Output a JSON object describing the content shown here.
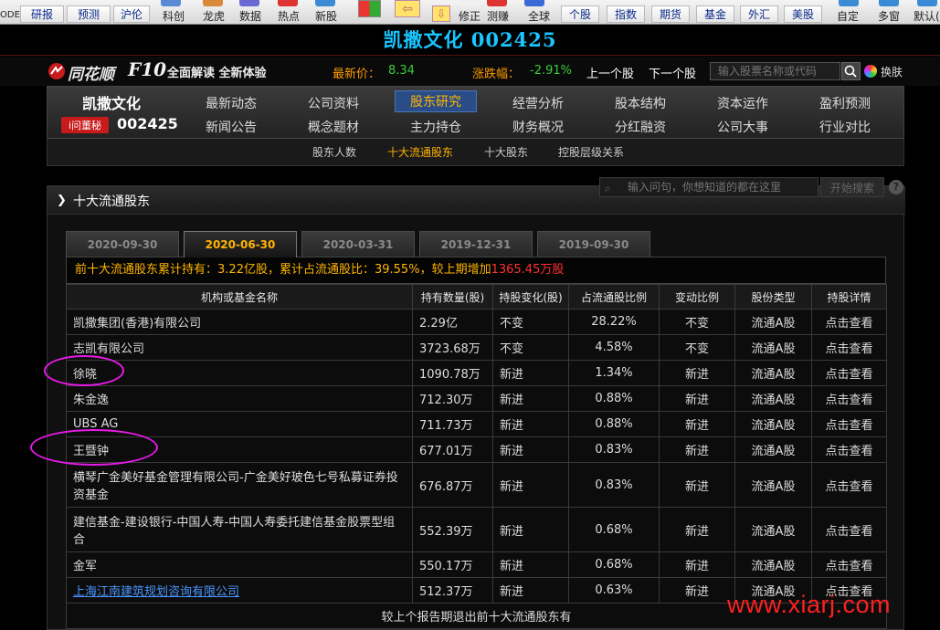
{
  "toolbar": {
    "top_buttons": [
      "研报",
      "预测",
      "沪伦",
      "个股",
      "指数",
      "期货",
      "基金",
      "外汇",
      "美股"
    ],
    "labels": [
      "科创",
      "龙虎",
      "数据",
      "热点",
      "新股",
      "修正",
      "测赚",
      "全球",
      "自定",
      "多窗",
      "默认(",
      "ODE"
    ]
  },
  "title": "凯撒文化 002425",
  "header": {
    "app_name": "同花顺",
    "app_suffix": "F10",
    "slogan": "全面解读 全新体验",
    "price_label": "最新价：",
    "price_value": "8.34",
    "change_label": "涨跌幅：",
    "change_value": "-2.91%",
    "prev_stock": "上一个股",
    "next_stock": "下一个股",
    "search_placeholder": "输入股票名称或代码",
    "switch_label": "换肤"
  },
  "nav": {
    "stock_name": "凯撒文化",
    "badge": "i问董秘",
    "stock_code": "002425",
    "row1": [
      "最新动态",
      "公司资料",
      "股东研究",
      "经营分析",
      "股本结构",
      "资本运作",
      "盈利预测"
    ],
    "row2": [
      "新闻公告",
      "概念题材",
      "主力持仓",
      "财务概况",
      "分红融资",
      "公司大事",
      "行业对比"
    ],
    "sub": [
      "股东人数",
      "十大流通股东",
      "十大股东",
      "控股层级关系"
    ]
  },
  "section": {
    "title": "十大流通股东",
    "ask_placeholder": "输入问句，你想知道的都在这里",
    "ask_button": "开始搜索",
    "help": "?"
  },
  "tabs": [
    "2020-09-30",
    "2020-06-30",
    "2020-03-31",
    "2019-12-31",
    "2019-09-30"
  ],
  "summary": {
    "p1": "前十大流通股东累计持有：",
    "holding": "3.22亿股",
    "p2": "，累计占流通股比：",
    "ratio": "39.55%",
    "p3": "，较上期增加",
    "increase": "1365.45万股"
  },
  "table": {
    "headers": [
      "机构或基金名称",
      "持有数量(股)",
      "持股变化(股)",
      "占流通股比例",
      "变动比例",
      "股份类型",
      "持股详情"
    ],
    "rows": [
      {
        "name": "凯撒集团(香港)有限公司",
        "amount": "2.29亿",
        "change": "不变",
        "pct": "28.22%",
        "ratio": "不变",
        "type": "流通A股",
        "detail": "点击查看"
      },
      {
        "name": "志凯有限公司",
        "amount": "3723.68万",
        "change": "不变",
        "pct": "4.58%",
        "ratio": "不变",
        "type": "流通A股",
        "detail": "点击查看"
      },
      {
        "name": "徐晓",
        "amount": "1090.78万",
        "change": "新进",
        "pct": "1.34%",
        "ratio": "新进",
        "type": "流通A股",
        "detail": "点击查看"
      },
      {
        "name": "朱金逸",
        "amount": "712.30万",
        "change": "新进",
        "pct": "0.88%",
        "ratio": "新进",
        "type": "流通A股",
        "detail": "点击查看"
      },
      {
        "name": "UBS AG",
        "amount": "711.73万",
        "change": "新进",
        "pct": "0.88%",
        "ratio": "新进",
        "type": "流通A股",
        "detail": "点击查看"
      },
      {
        "name": "王暨钟",
        "amount": "677.01万",
        "change": "新进",
        "pct": "0.83%",
        "ratio": "新进",
        "type": "流通A股",
        "detail": "点击查看"
      },
      {
        "name": "横琴广金美好基金管理有限公司-广金美好玻色七号私募证券投资基金",
        "amount": "676.87万",
        "change": "新进",
        "pct": "0.83%",
        "ratio": "新进",
        "type": "流通A股",
        "detail": "点击查看"
      },
      {
        "name": "建信基金-建设银行-中国人寿-中国人寿委托建信基金股票型组合",
        "amount": "552.39万",
        "change": "新进",
        "pct": "0.68%",
        "ratio": "新进",
        "type": "流通A股",
        "detail": "点击查看"
      },
      {
        "name": "金军",
        "amount": "550.17万",
        "change": "新进",
        "pct": "0.68%",
        "ratio": "新进",
        "type": "流通A股",
        "detail": "点击查看"
      },
      {
        "name": "上海江南建筑规划咨询有限公司",
        "amount": "512.37万",
        "change": "新进",
        "pct": "0.63%",
        "ratio": "新进",
        "type": "流通A股",
        "detail": "点击查看"
      }
    ],
    "footer": "较上个报告期退出前十大流通股东有"
  },
  "watermark": "www.xiarj.com"
}
